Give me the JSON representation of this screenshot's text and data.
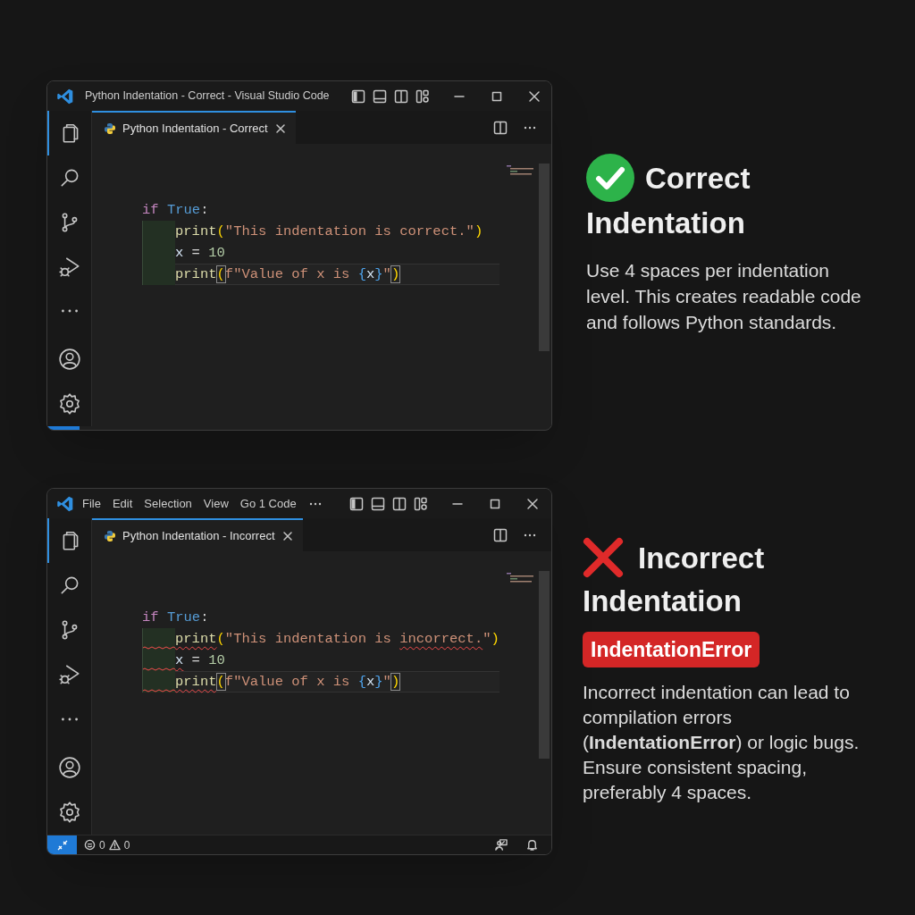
{
  "windows": [
    {
      "title": "Python Indentation - Correct - Visual Studio Code",
      "tab": {
        "label": "Python Indentation - Correct",
        "selected": true
      },
      "code": [
        {
          "indented": false,
          "current": false,
          "tokens": [
            {
              "kind": "keyword",
              "text": "if"
            },
            {
              "kind": "constant",
              "text": " True"
            },
            {
              "kind": "punct",
              "text": ":"
            }
          ]
        },
        {
          "indented": true,
          "indent_error": false,
          "current": false,
          "tokens": [
            {
              "kind": "function",
              "text": "print"
            },
            {
              "kind": "bracket",
              "text": "("
            },
            {
              "kind": "string",
              "text": "\"This indentation is correct.\""
            },
            {
              "kind": "bracket",
              "text": ")"
            }
          ]
        },
        {
          "indented": true,
          "indent_error": false,
          "current": false,
          "tokens": [
            {
              "kind": "variable",
              "text": "x"
            },
            {
              "kind": "punct",
              "text": " = "
            },
            {
              "kind": "number",
              "text": "10"
            }
          ]
        },
        {
          "indented": true,
          "indent_error": false,
          "current": true,
          "tokens": [
            {
              "kind": "function",
              "text": "print"
            },
            {
              "kind": "bracket",
              "text": "(",
              "matched": true
            },
            {
              "kind": "string",
              "text": "f\"Value of x is "
            },
            {
              "kind": "brace",
              "text": "{"
            },
            {
              "kind": "variable",
              "text": "x"
            },
            {
              "kind": "brace",
              "text": "}"
            },
            {
              "kind": "string",
              "text": "\""
            },
            {
              "kind": "bracket",
              "text": ")",
              "matched": true
            }
          ]
        }
      ],
      "side": {
        "kind": "correct",
        "heading": "Correct Indentation",
        "text": "Use 4 spaces per indentation level. This creates readable code and follows Python standards."
      }
    },
    {
      "menu": [
        "File",
        "Edit",
        "Selection",
        "View",
        "Go 1 Code"
      ],
      "tab": {
        "label": "Python Indentation - Incorrect",
        "selected": true
      },
      "code": [
        {
          "indented": false,
          "current": false,
          "tokens": [
            {
              "kind": "keyword",
              "text": "if"
            },
            {
              "kind": "constant",
              "text": " True"
            },
            {
              "kind": "punct",
              "text": ":"
            }
          ]
        },
        {
          "indented": true,
          "indent_error": true,
          "current": false,
          "tokens": [
            {
              "kind": "function",
              "text": "print",
              "error": true
            },
            {
              "kind": "bracket",
              "text": "("
            },
            {
              "kind": "string",
              "text": "\"This indentation is "
            },
            {
              "kind": "string",
              "text": "incorrect.",
              "error": true
            },
            {
              "kind": "string",
              "text": "\""
            },
            {
              "kind": "bracket",
              "text": ")"
            }
          ]
        },
        {
          "indented": true,
          "indent_error": true,
          "current": false,
          "tokens": [
            {
              "kind": "variable",
              "text": "x",
              "error": true
            },
            {
              "kind": "punct",
              "text": " = "
            },
            {
              "kind": "number",
              "text": "10"
            }
          ]
        },
        {
          "indented": true,
          "indent_error": true,
          "current": true,
          "tokens": [
            {
              "kind": "function",
              "text": "print",
              "error": true
            },
            {
              "kind": "bracket",
              "text": "(",
              "matched": true
            },
            {
              "kind": "string",
              "text": "f\"Value of x is "
            },
            {
              "kind": "brace",
              "text": "{"
            },
            {
              "kind": "variable",
              "text": "x"
            },
            {
              "kind": "brace",
              "text": "}"
            },
            {
              "kind": "string",
              "text": "\""
            },
            {
              "kind": "bracket",
              "text": ")",
              "matched": true
            }
          ]
        }
      ],
      "status_bar": {
        "errors": "0",
        "warnings": "0"
      },
      "side": {
        "kind": "incorrect",
        "heading": "Incorrect Indentation",
        "badge": "IndentationError",
        "text": "Incorrect indentation can lead to compilation errors (**IndentationError**) or logic bugs. Ensure consistent spacing, preferably 4 spaces."
      }
    }
  ]
}
